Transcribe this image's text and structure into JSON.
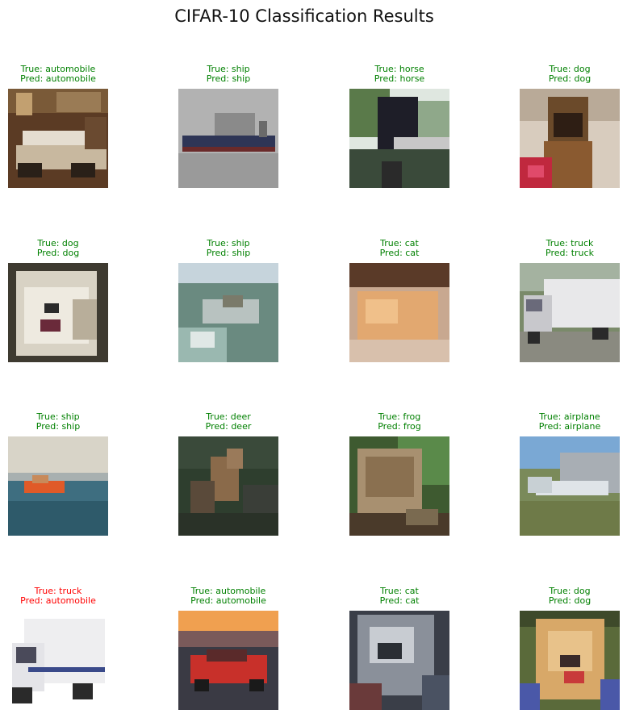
{
  "title": "CIFAR-10 Classification Results",
  "colors": {
    "correct": "#008000",
    "incorrect": "#ff0000"
  },
  "grid": [
    {
      "true_label": "True: automobile",
      "pred_label": "Pred: automobile",
      "correct": true
    },
    {
      "true_label": "True: ship",
      "pred_label": "Pred: ship",
      "correct": true
    },
    {
      "true_label": "True: horse",
      "pred_label": "Pred: horse",
      "correct": true
    },
    {
      "true_label": "True: dog",
      "pred_label": "Pred: dog",
      "correct": true
    },
    {
      "true_label": "True: dog",
      "pred_label": "Pred: dog",
      "correct": true
    },
    {
      "true_label": "True: ship",
      "pred_label": "Pred: ship",
      "correct": true
    },
    {
      "true_label": "True: cat",
      "pred_label": "Pred: cat",
      "correct": true
    },
    {
      "true_label": "True: truck",
      "pred_label": "Pred: truck",
      "correct": true
    },
    {
      "true_label": "True: ship",
      "pred_label": "Pred: ship",
      "correct": true
    },
    {
      "true_label": "True: deer",
      "pred_label": "Pred: deer",
      "correct": true
    },
    {
      "true_label": "True: frog",
      "pred_label": "Pred: frog",
      "correct": true
    },
    {
      "true_label": "True: airplane",
      "pred_label": "Pred: airplane",
      "correct": true
    },
    {
      "true_label": "True: truck",
      "pred_label": "Pred: automobile",
      "correct": false
    },
    {
      "true_label": "True: automobile",
      "pred_label": "Pred: automobile",
      "correct": true
    },
    {
      "true_label": "True: cat",
      "pred_label": "Pred: cat",
      "correct": true
    },
    {
      "true_label": "True: dog",
      "pred_label": "Pred: dog",
      "correct": true
    }
  ]
}
